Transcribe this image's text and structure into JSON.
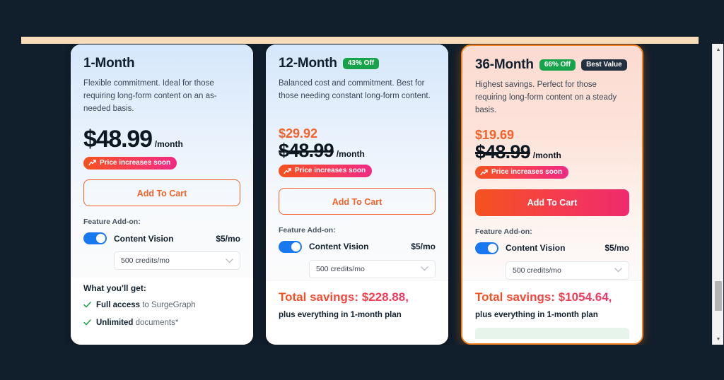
{
  "window": {
    "background_color": "#111e2b",
    "accent_orange": "#f2622a",
    "accent_pink": "#ef2a6e",
    "toggle_on_color": "#1878f0"
  },
  "scrollbar": {
    "up_arrow": "▲",
    "down_arrow": "▼"
  },
  "plans": [
    {
      "title": "1-Month",
      "badges": [],
      "description": "Flexible commitment. Ideal for those requiring long-form content on an as-needed basis.",
      "discount_price": "",
      "old_price": "$48.99",
      "per_month": "/month",
      "price_badge": "Price increases soon",
      "cta_label": "Add To Cart",
      "cta_style": "outline",
      "addon_label": "Feature Add-on:",
      "addon_name": "Content Vision",
      "addon_price": "$5/mo",
      "addon_credits": "500 credits/mo",
      "bottom_type": "features",
      "whats_included_title": "What you'll get:",
      "features": [
        {
          "bold": "Full access",
          "rest": " to SurgeGraph"
        },
        {
          "bold": "Unlimited",
          "rest": " documents*"
        }
      ]
    },
    {
      "title": "12-Month",
      "badges": [
        {
          "label": "43% Off",
          "color": "green"
        }
      ],
      "description": "Balanced cost and commitment. Best for those needing constant long-form content.",
      "discount_price": "$29.92",
      "old_price": "$48.99",
      "per_month": "/month",
      "price_badge": "Price increases soon",
      "cta_label": "Add To Cart",
      "cta_style": "outline",
      "addon_label": "Feature Add-on:",
      "addon_name": "Content Vision",
      "addon_price": "$5/mo",
      "addon_credits": "500 credits/mo",
      "bottom_type": "savings",
      "savings_title": "Total savings: $228.88,",
      "savings_sub": "plus everything in 1-month plan"
    },
    {
      "title": "36-Month",
      "badges": [
        {
          "label": "66% Off",
          "color": "green"
        },
        {
          "label": "Best Value",
          "color": "dark"
        }
      ],
      "description": "Highest savings. Perfect for those requiring long-form content on a steady basis.",
      "discount_price": "$19.69",
      "old_price": "$48.99",
      "per_month": "/month",
      "price_badge": "Price increases soon",
      "cta_label": "Add To Cart",
      "cta_style": "filled",
      "addon_label": "Feature Add-on:",
      "addon_name": "Content Vision",
      "addon_price": "$5/mo",
      "addon_credits": "500 credits/mo",
      "bottom_type": "savings",
      "savings_title": "Total savings: $1054.64,",
      "savings_sub": "plus everything in 1-month plan"
    }
  ]
}
